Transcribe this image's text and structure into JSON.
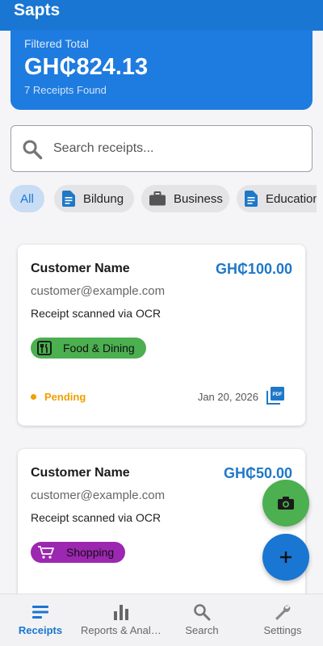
{
  "app": {
    "title": "Sapts"
  },
  "summary": {
    "label": "Filtered Total",
    "total": "GH₵824.13",
    "count": "7 Receipts Found"
  },
  "search": {
    "placeholder": "Search receipts..."
  },
  "filters": [
    {
      "label": "All",
      "selected": true
    },
    {
      "label": "Bildung",
      "icon": "document-icon"
    },
    {
      "label": "Business",
      "icon": "briefcase-icon"
    },
    {
      "label": "Education",
      "icon": "document-icon"
    }
  ],
  "receipts": [
    {
      "name": "Customer Name",
      "amount": "GH₵100.00",
      "email": "customer@example.com",
      "description": "Receipt scanned via OCR",
      "category": "Food & Dining",
      "category_color": "#4caf50",
      "category_icon": "restaurant-icon",
      "status": "Pending",
      "status_color": "#f0a000",
      "date": "Jan 20, 2026",
      "attachment_icon": "pdf-icon"
    },
    {
      "name": "Customer Name",
      "amount": "GH₵50.00",
      "email": "customer@example.com",
      "description": "Receipt scanned via OCR",
      "category": "Shopping",
      "category_color": "#9c27b0",
      "category_icon": "cart-icon"
    }
  ],
  "fabs": {
    "camera_icon": "camera-icon",
    "add_icon": "plus-icon"
  },
  "nav": [
    {
      "label": "Receipts",
      "icon": "receipts-icon",
      "active": true
    },
    {
      "label": "Reports & Analytics",
      "icon": "bar-chart-icon"
    },
    {
      "label": "Search",
      "icon": "search-icon"
    },
    {
      "label": "Settings",
      "icon": "settings-icon"
    }
  ],
  "colors": {
    "primary": "#1976d2",
    "accent_green": "#4caf50",
    "accent_purple": "#9c27b0",
    "pending": "#f0a000"
  }
}
